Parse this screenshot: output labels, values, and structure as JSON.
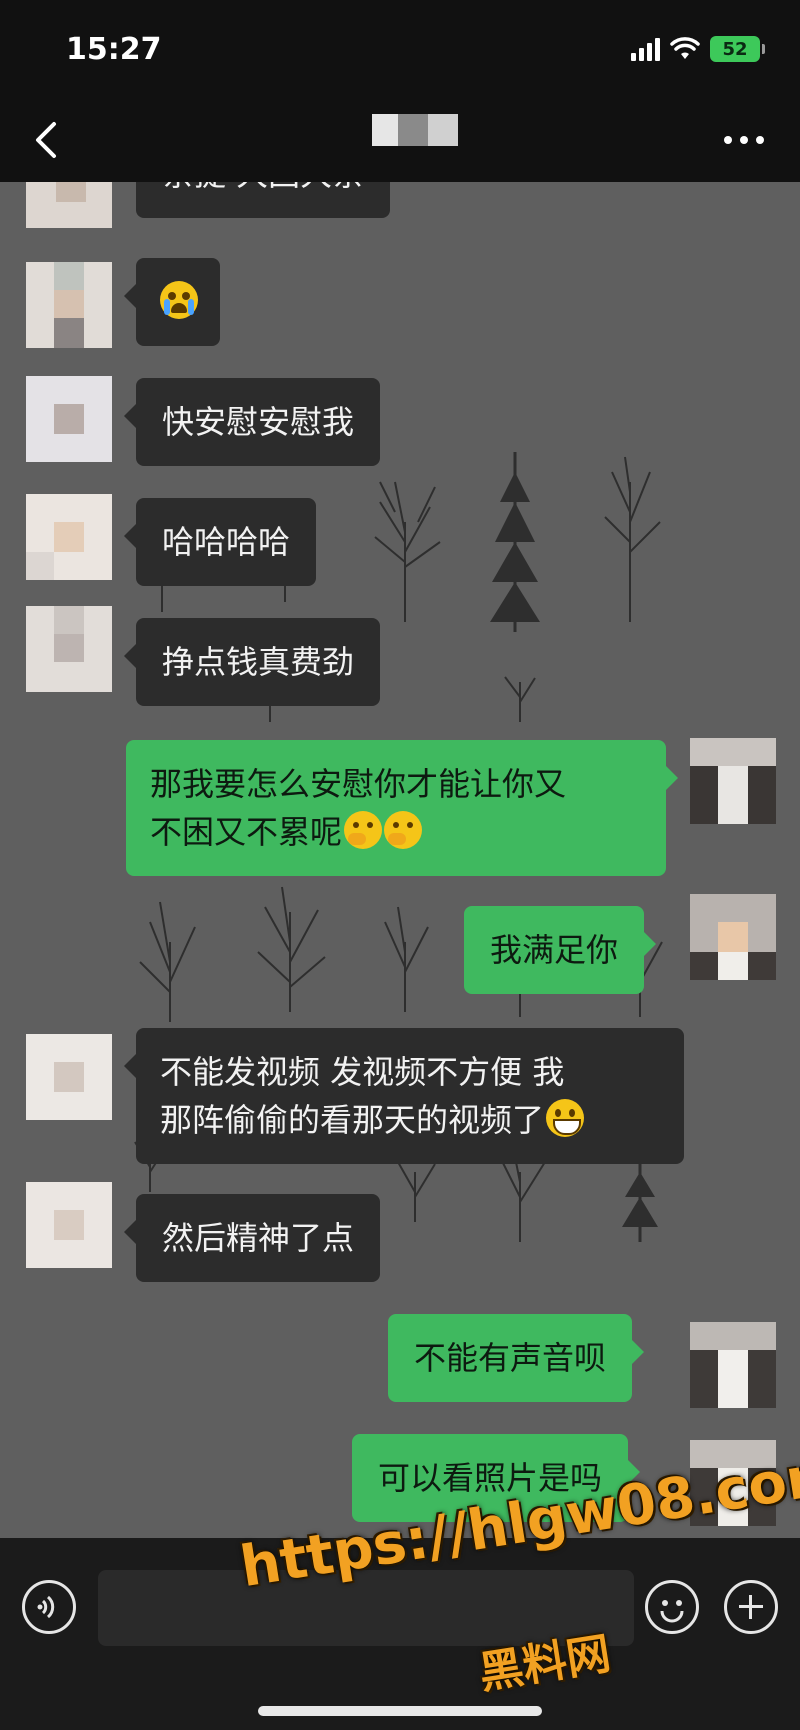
{
  "status_bar": {
    "time": "15:27",
    "battery": "52"
  },
  "nav": {
    "back_icon": "chevron-left-icon",
    "more_icon": "ellipsis-icon"
  },
  "messages": [
    {
      "side": "in",
      "text": "亲提  大国大亲"
    },
    {
      "side": "in",
      "emoji": "crying-face"
    },
    {
      "side": "in",
      "text": "快安慰安慰我"
    },
    {
      "side": "in",
      "text": "哈哈哈哈"
    },
    {
      "side": "in",
      "text": "挣点钱真费劲"
    },
    {
      "side": "out",
      "line1": "那我要怎么安慰你才能让你又",
      "line2": "不困又不累呢",
      "emoji": "thinking-face"
    },
    {
      "side": "out",
      "text": "我满足你"
    },
    {
      "side": "in",
      "line1": "不能发视频  发视频不方便  我",
      "line2": "那阵偷偷的看那天的视频了",
      "emoji": "grinning-face"
    },
    {
      "side": "in",
      "text": "然后精神了点"
    },
    {
      "side": "out",
      "text": "不能有声音呗"
    },
    {
      "side": "out",
      "text": "可以看照片是吗"
    }
  ],
  "input_bar": {
    "voice_icon": "voice-icon",
    "emoji_icon": "smiley-icon",
    "plus_icon": "plus-icon"
  },
  "watermark": {
    "url": "https://hlgw08.com",
    "site": "黑料网"
  },
  "colors": {
    "incoming_bubble": "#2c2c2c",
    "outgoing_bubble": "#3fb95f",
    "chat_background": "#5f5f5f",
    "watermark": "#f2a122"
  }
}
